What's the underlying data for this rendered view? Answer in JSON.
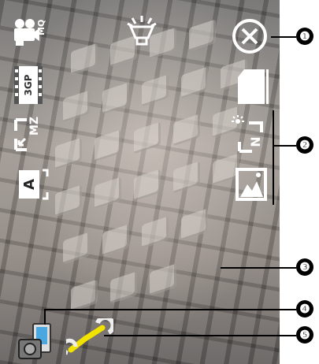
{
  "camera": {
    "video_mode_icon": "video-camera-mq-icon",
    "flash_icon": "flash-lamp-icon",
    "close_icon": "close-circle-x-icon",
    "format_icon": "film-3gp-icon",
    "format_label": "3GP",
    "zoom_icon": "zoom-mz-icon",
    "mode_a_icon": "auto-focus-a-icon",
    "storage_icon": "memory-card-icon",
    "brightness_icon": "brightness-n-icon",
    "scene_icon": "scene-landscape-icon",
    "device_icon": "device-switch-icon",
    "tools_icon": "wrench-tools-icon"
  },
  "callouts": [
    "❶",
    "❷",
    "❸",
    "❹",
    "❺"
  ]
}
